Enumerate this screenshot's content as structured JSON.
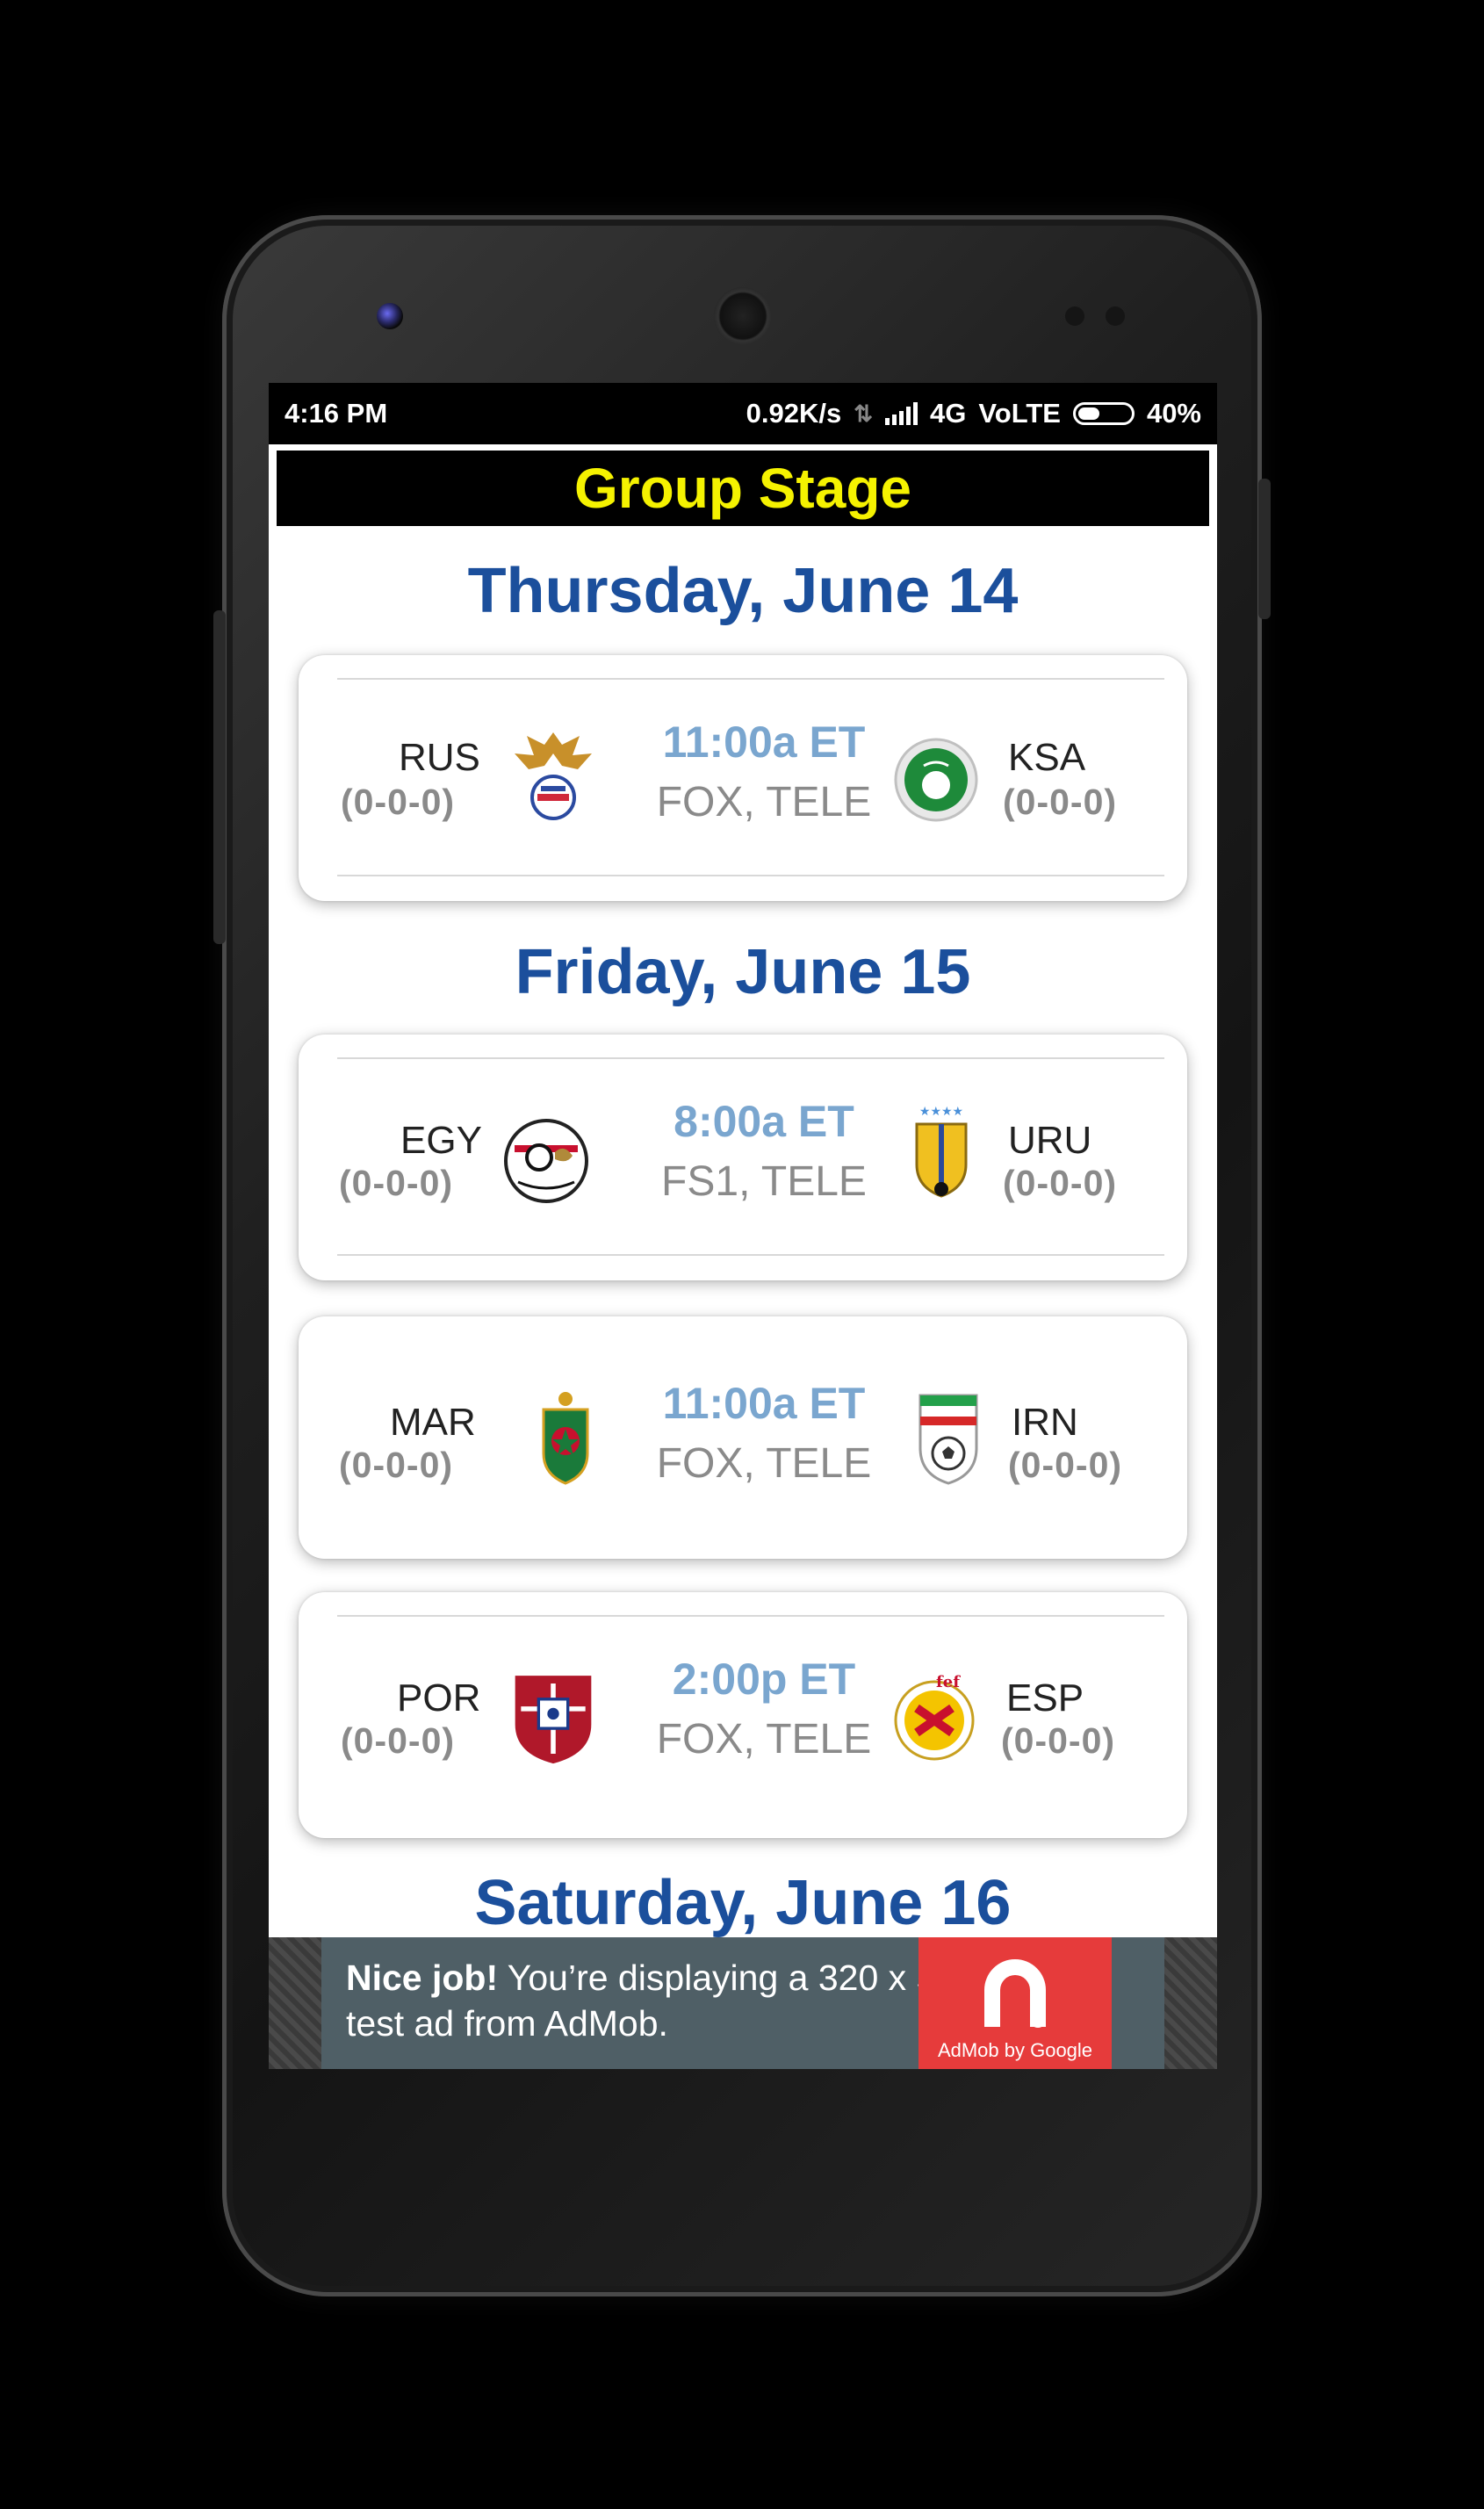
{
  "status_bar": {
    "time": "4:16 PM",
    "speed": "0.92K/s",
    "network": "4G",
    "volte": "VoLTE",
    "battery": "40%"
  },
  "header": {
    "title": "Group Stage"
  },
  "days": [
    {
      "label": "Thursday, June 14"
    },
    {
      "label": "Friday, June 15"
    },
    {
      "label": "Saturday, June 16"
    }
  ],
  "matches": [
    {
      "home": "RUS",
      "home_record": "(0-0-0)",
      "away": "KSA",
      "away_record": "(0-0-0)",
      "time": "11:00a ET",
      "tv": "FOX, TELE"
    },
    {
      "home": "EGY",
      "home_record": "(0-0-0)",
      "away": "URU",
      "away_record": "(0-0-0)",
      "time": "8:00a ET",
      "tv": "FS1, TELE"
    },
    {
      "home": "MAR",
      "home_record": "(0-0-0)",
      "away": "IRN",
      "away_record": "(0-0-0)",
      "time": "11:00a ET",
      "tv": "FOX, TELE"
    },
    {
      "home": "POR",
      "home_record": "(0-0-0)",
      "away": "ESP",
      "away_record": "(0-0-0)",
      "time": "2:00p ET",
      "tv": "FOX, TELE"
    }
  ],
  "ad": {
    "bold": "Nice job!",
    "text": " You’re displaying a 320 x 50 test ad from AdMob.",
    "brand": "AdMob by Google"
  },
  "colors": {
    "header_title": "#f5f200",
    "day_heading": "#1b4f9c",
    "match_time": "#7aa6cf",
    "ad_red": "#e63b3b"
  }
}
